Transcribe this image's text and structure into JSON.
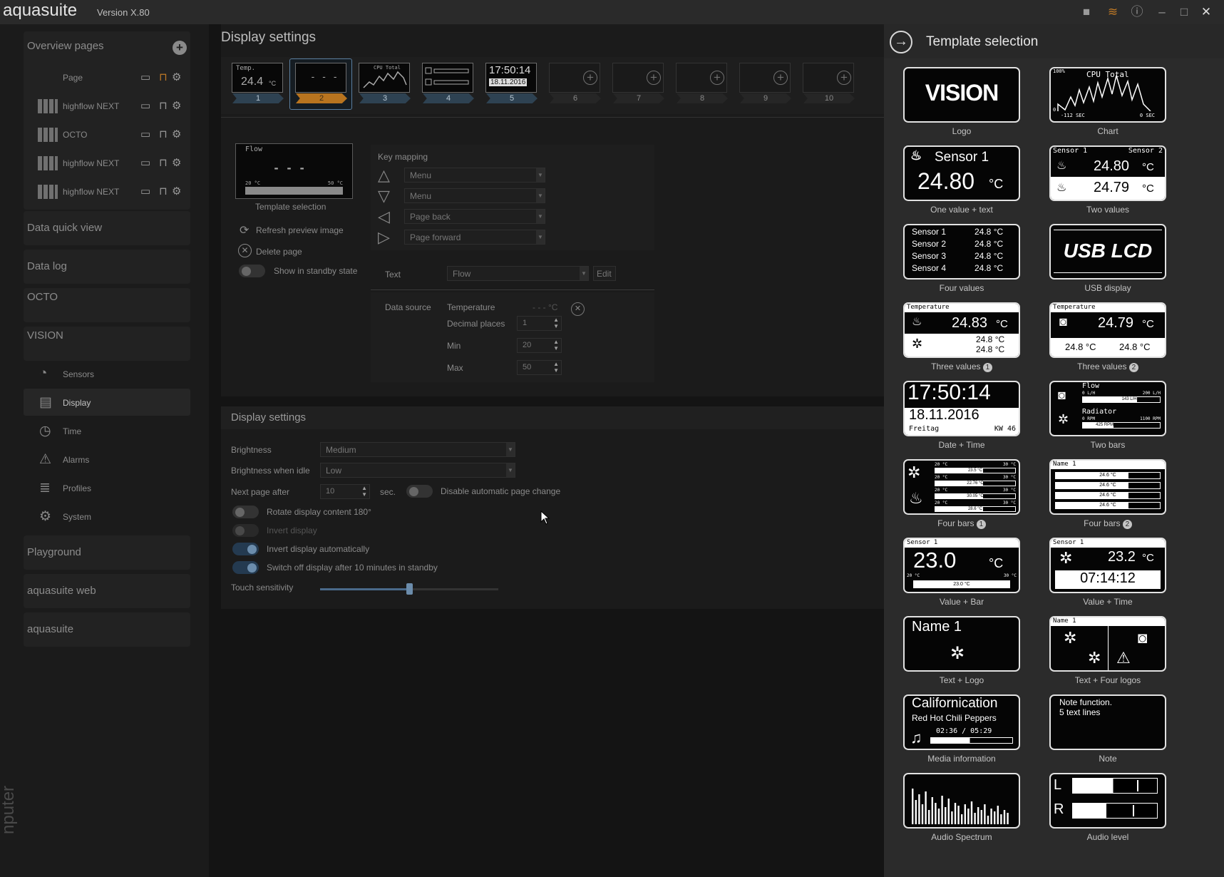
{
  "app": {
    "name": "aquasuite",
    "version": "Version X.80"
  },
  "sidebar": {
    "overview_title": "Overview pages",
    "overview_rows": [
      {
        "label": "Page"
      },
      {
        "label": "highflow NEXT"
      },
      {
        "label": "OCTO"
      },
      {
        "label": "highflow NEXT"
      },
      {
        "label": "highflow NEXT"
      }
    ],
    "groups": [
      "Data quick view",
      "Data log",
      "OCTO",
      "VISION"
    ],
    "vision_items": [
      "Sensors",
      "Display",
      "Time",
      "Alarms",
      "Profiles",
      "System"
    ],
    "groups_bottom": [
      "Playground",
      "aquasuite web",
      "aquasuite"
    ],
    "vertical_text": "nputer"
  },
  "display_settings": {
    "title": "Display settings",
    "pages": [
      {
        "number": "1",
        "preview": "Temp.",
        "value": "24.4",
        "unit": "°C"
      },
      {
        "number": "2",
        "selected": true
      },
      {
        "number": "3",
        "preview": "CPU Total"
      },
      {
        "number": "4"
      },
      {
        "number": "5",
        "time": "17:50:14",
        "date": "18.11.2016"
      },
      {
        "number": "6"
      },
      {
        "number": "7"
      },
      {
        "number": "8"
      },
      {
        "number": "9"
      },
      {
        "number": "10"
      }
    ],
    "preview": {
      "label": "Flow",
      "dashes": "- - -",
      "min": "20 °C",
      "max": "50 °C"
    },
    "template_selection_label": "Template selection",
    "refresh_label": "Refresh preview image",
    "delete_label": "Delete page",
    "standby_label": "Show in standby state",
    "key_mapping": {
      "title": "Key mapping",
      "keys": [
        "Menu",
        "Menu",
        "Page back",
        "Page forward"
      ]
    },
    "text": {
      "label": "Text",
      "value": "Flow",
      "edit": "Edit"
    },
    "data_source": {
      "label": "Data source",
      "name": "Temperature",
      "value": "- - - °C",
      "decimal_label": "Decimal places",
      "decimal": "1",
      "min_label": "Min",
      "min": "20",
      "max_label": "Max",
      "max": "50"
    }
  },
  "display_settings2": {
    "title": "Display settings",
    "brightness_label": "Brightness",
    "brightness": "Medium",
    "idle_label": "Brightness when idle",
    "idle": "Low",
    "next_label": "Next page after",
    "next": "10",
    "sec": "sec.",
    "disable_label": "Disable automatic page change",
    "rotate_label": "Rotate display content 180°",
    "invert_label": "Invert display",
    "invert_auto_label": "Invert display automatically",
    "switch_off_label": "Switch off display after 10 minutes in standby",
    "touch_label": "Touch sensitivity",
    "touch_level": 0.5
  },
  "template_panel": {
    "title": "Template selection",
    "templates": [
      {
        "label": "Logo",
        "text": "VISION"
      },
      {
        "label": "Chart",
        "text": "CPU Total",
        "t1": "100%",
        "t2": "-112 SEC",
        "t3": "0 SEC",
        "t4": "0"
      },
      {
        "label": "One value + text",
        "t1": "Sensor 1",
        "t2": "24.80",
        "t3": "°C"
      },
      {
        "label": "Two values",
        "t1": "Sensor 1",
        "t2": "Sensor 2",
        "v1": "24.80",
        "v2": "24.79",
        "u": "°C"
      },
      {
        "label": "Four values",
        "rows": [
          [
            "Sensor 1",
            "24.8 °C"
          ],
          [
            "Sensor 2",
            "24.8 °C"
          ],
          [
            "Sensor 3",
            "24.8 °C"
          ],
          [
            "Sensor 4",
            "24.8 °C"
          ]
        ]
      },
      {
        "label": "USB display",
        "text": "USB LCD"
      },
      {
        "label": "Three values",
        "badge": "1",
        "t1": "Temperature",
        "v": "24.83",
        "u": "°C",
        "a": "24.8 °C",
        "b": "24.8 °C"
      },
      {
        "label": "Three values",
        "badge": "2",
        "t1": "Temperature",
        "v": "24.79",
        "u": "°C",
        "a": "24.8 °C",
        "b": "24.8 °C"
      },
      {
        "label": "Date + Time",
        "t1": "17:50:14",
        "t2": "18.11.2016",
        "t3": "Freitag",
        "t4": "KW 46"
      },
      {
        "label": "Two bars",
        "t1": "Flow",
        "t2": "Radiator",
        "a1": "0 L/H",
        "a2": "200 L/H",
        "a3": "143 L/H",
        "b1": "0 RPM",
        "b2": "1100 RPM",
        "b3": "425 RPM"
      },
      {
        "label": "Four bars",
        "badge": "1",
        "vals": [
          "23.5 °C",
          "22.76 °C",
          "30.05 °C",
          "28.6 °C"
        ],
        "lo": "20 °C",
        "hi": "30 °C"
      },
      {
        "label": "Four bars",
        "badge": "2",
        "t1": "Name 1",
        "vals": [
          "24.6 °C",
          "24.6 °C",
          "24.6 °C",
          "24.6 °C"
        ]
      },
      {
        "label": "Value + Bar",
        "t1": "Sensor 1",
        "v": "23.0",
        "u": "°C",
        "lo": "20 °C",
        "hi": "30 °C",
        "bar": "23.0 °C"
      },
      {
        "label": "Value + Time",
        "t1": "Sensor 1",
        "v": "23.2",
        "u": "°C",
        "time": "07:14:12"
      },
      {
        "label": "Text + Logo",
        "t1": "Name 1"
      },
      {
        "label": "Text + Four logos",
        "t1": "Name 1"
      },
      {
        "label": "Media information",
        "t1": "Californication",
        "t2": "Red Hot Chili Peppers",
        "t3": "02:36 / 05:29"
      },
      {
        "label": "Note",
        "t1": "Note function.",
        "t2": "5 text lines"
      },
      {
        "label": "Audio Spectrum"
      },
      {
        "label": "Audio level",
        "l": "L",
        "r": "R"
      }
    ]
  },
  "colors": {
    "accent": "#b8741f",
    "select": "#5b7fa0"
  }
}
